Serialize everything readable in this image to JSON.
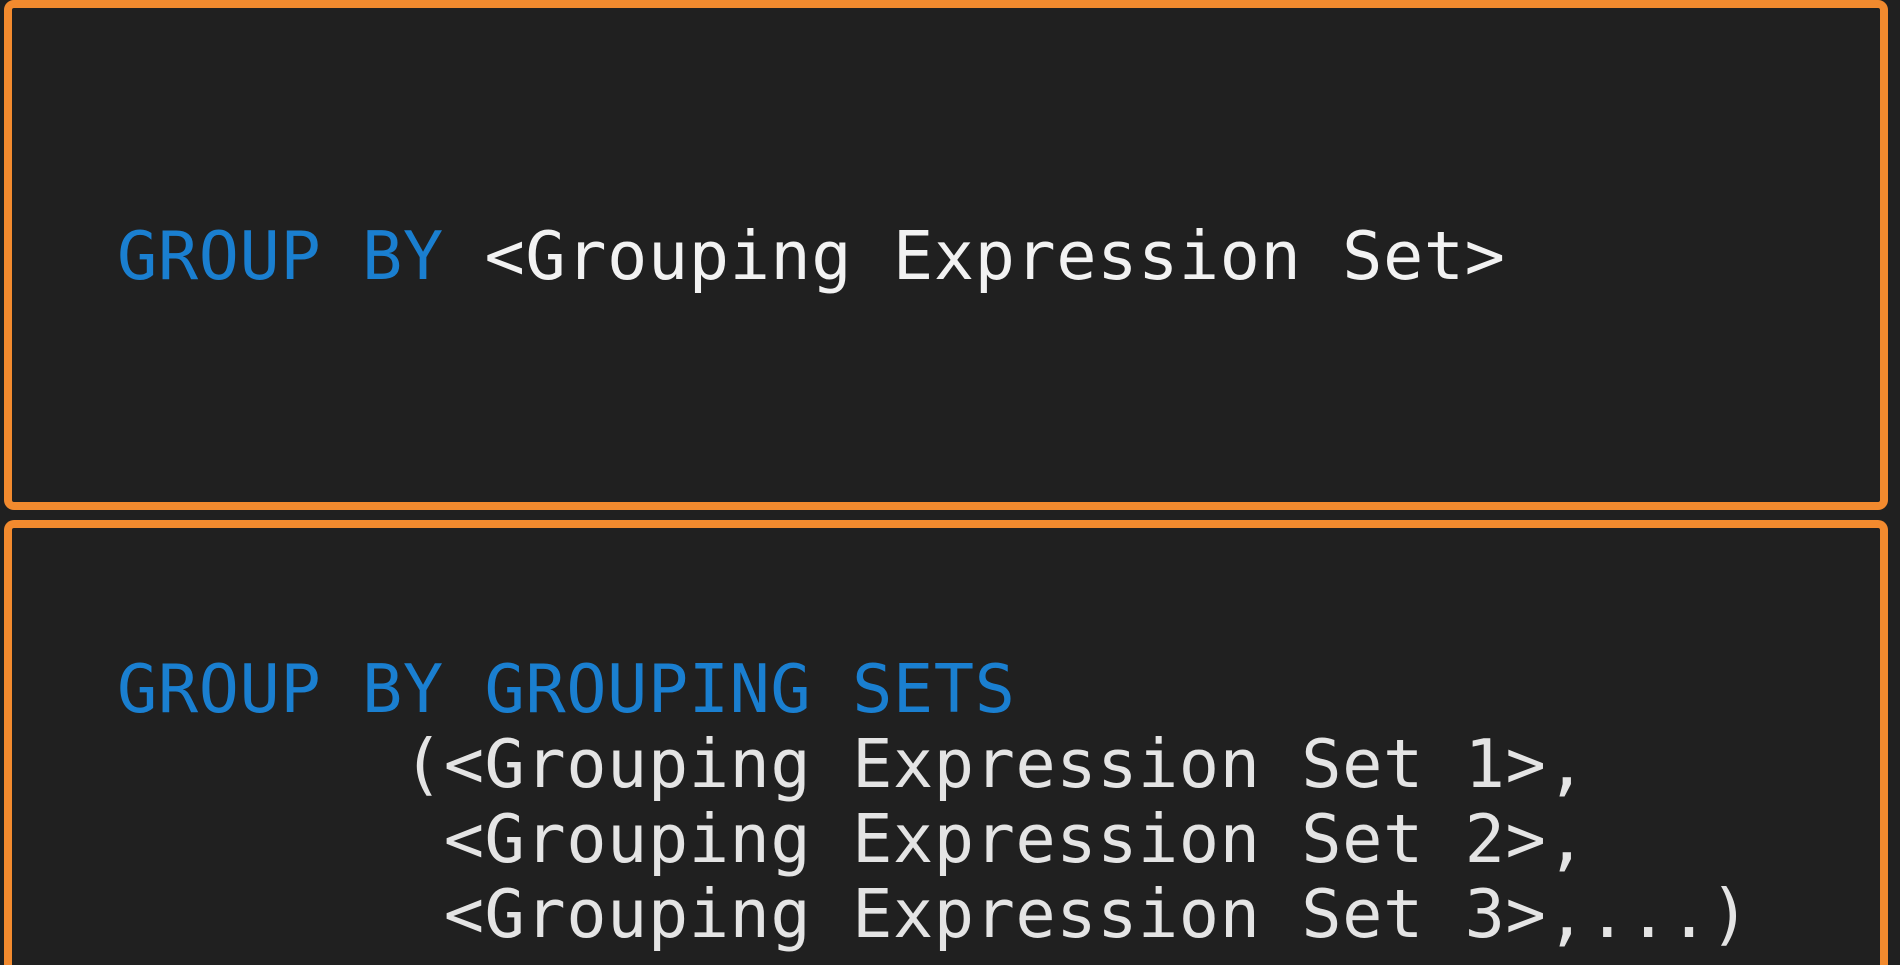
{
  "colors": {
    "border": "#f28a2e",
    "background": "#202020",
    "keyword": "#1a7fd0",
    "text": "#f2f2f2"
  },
  "top_panel": {
    "keyword": "GROUP BY",
    "argument": "<Grouping Expression Set>"
  },
  "bottom_panel": {
    "keyword": "GROUP BY GROUPING SETS",
    "lines": [
      "       (<Grouping Expression Set 1>,",
      "        <Grouping Expression Set 2>,",
      "        <Grouping Expression Set 3>,...)"
    ]
  }
}
